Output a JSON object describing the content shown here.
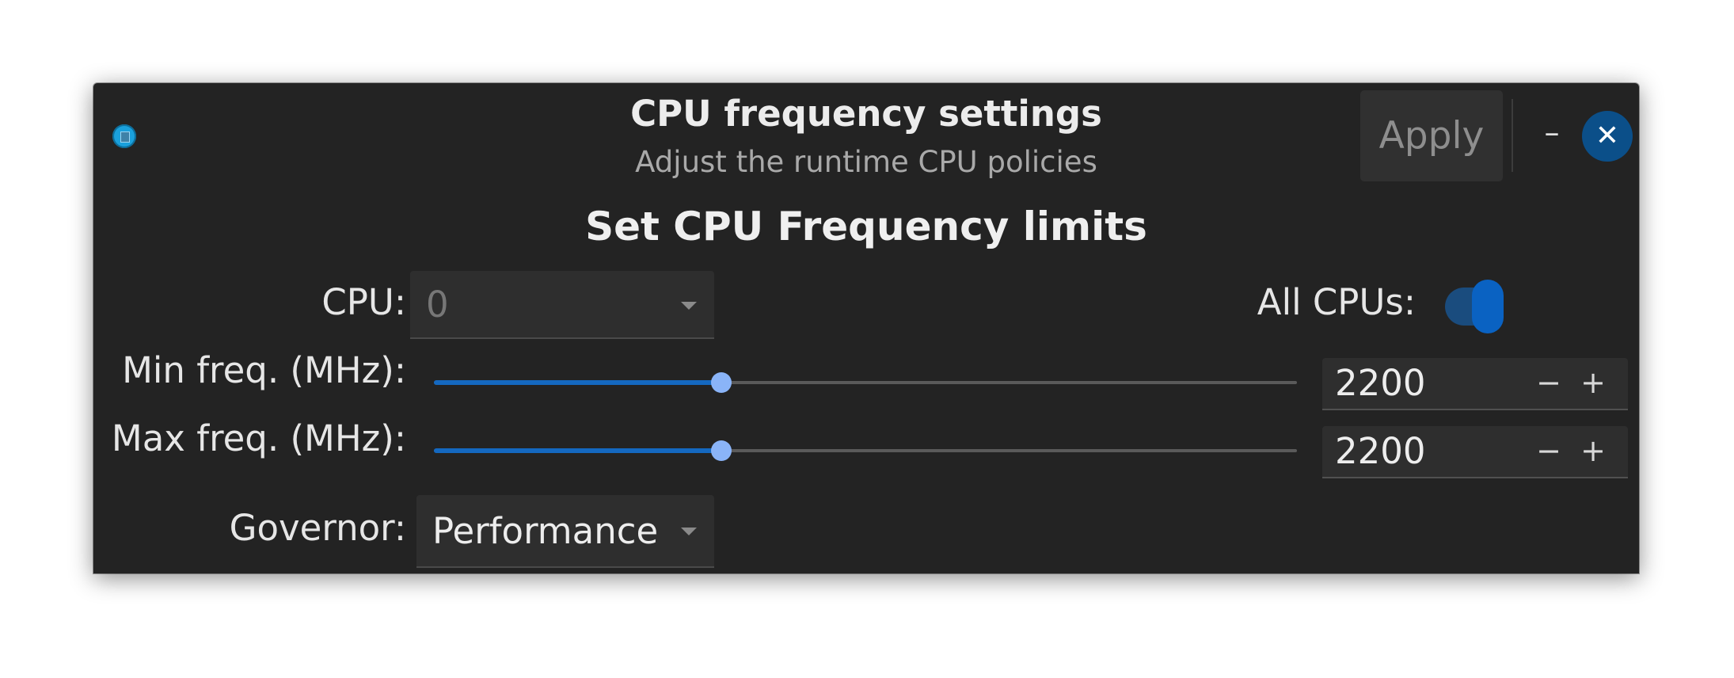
{
  "header": {
    "title": "CPU frequency settings",
    "subtitle": "Adjust the runtime CPU policies",
    "apply_label": "Apply",
    "minimize_label": "–",
    "close_label": "✕"
  },
  "section": {
    "title": "Set CPU Frequency limits"
  },
  "cpu": {
    "label": "CPU:",
    "value": "0",
    "disabled": true
  },
  "all_cpus": {
    "label": "All CPUs:",
    "enabled": true
  },
  "min_freq": {
    "label": "Min freq. (MHz):",
    "value": "2200",
    "slider_fraction": 0.333,
    "dec_label": "−",
    "inc_label": "+"
  },
  "max_freq": {
    "label": "Max freq. (MHz):",
    "value": "2200",
    "slider_fraction": 0.333,
    "dec_label": "−",
    "inc_label": "+"
  },
  "governor": {
    "label": "Governor:",
    "value": "Performance"
  },
  "colors": {
    "window_bg": "#232323",
    "accent": "#1468c0",
    "slider_knob": "#8ab4f8",
    "close_button": "#0b4f89"
  }
}
